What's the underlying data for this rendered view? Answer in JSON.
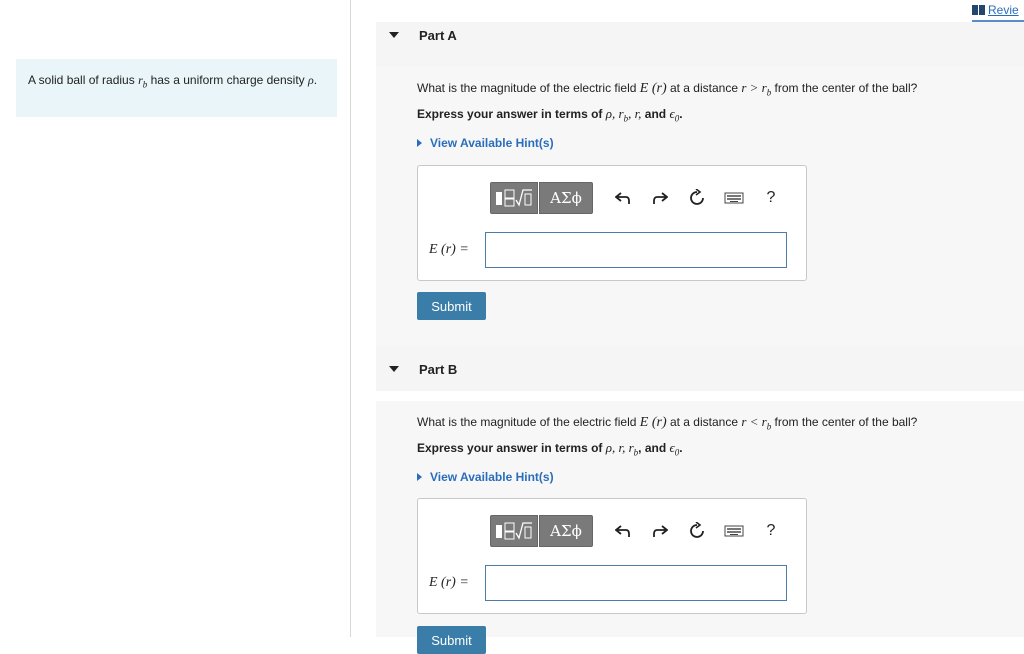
{
  "review": {
    "label": "Revie"
  },
  "intro": {
    "text_1": "A solid ball of radius ",
    "var_rb": "r",
    "sub_b": "b",
    "text_2": " has a uniform charge density ",
    "var_rho": "ρ",
    "text_3": "."
  },
  "partA": {
    "title": "Part A",
    "q_1": "What is the magnitude of the electric field ",
    "q_E": "E (r)",
    "q_2": " at a distance ",
    "q_cond": "r > r",
    "q_sub": "b",
    "q_3": " from the center of the ball?",
    "express_1": "Express your answer in terms of ",
    "express_vars": "ρ, r",
    "express_sub": "b",
    "express_vars2": ", r,",
    "express_and": " and ",
    "express_eps": "ϵ",
    "express_eps_sub": "0",
    "express_end": ".",
    "hint": "View Available Hint(s)",
    "input_label": "E (r) =",
    "input_value": "",
    "submit": "Submit"
  },
  "partB": {
    "title": "Part B",
    "q_1": "What is the magnitude of the electric field ",
    "q_E": "E (r)",
    "q_2": " at a distance ",
    "q_cond": "r < r",
    "q_sub": "b",
    "q_3": " from the center of the ball?",
    "express_1": "Express your answer in terms of ",
    "express_vars": "ρ, r, r",
    "express_sub": "b",
    "express_and": ", and ",
    "express_eps": "ϵ",
    "express_eps_sub": "0",
    "express_end": ".",
    "hint": "View Available Hint(s)",
    "input_label": "E (r) =",
    "input_value": "",
    "submit": "Submit"
  },
  "toolbar": {
    "greek_label": "ΑΣϕ",
    "help_label": "?"
  }
}
